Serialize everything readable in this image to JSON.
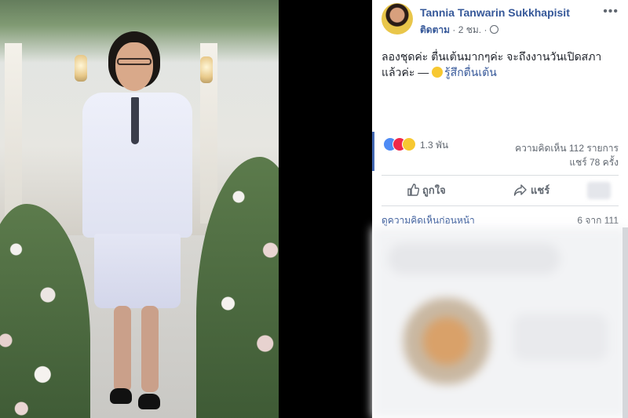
{
  "post": {
    "author": "Tannia Tanwarin Sukkhapisit",
    "follow_label": "ติดตาม",
    "dot": "·",
    "time": "2 ชม.",
    "more_icon": "•••",
    "text": "ลองชุดค่ะ ตื่นเต้นมากๆค่ะ จะถึงงานวันเปิดสภาแล้วค่ะ — ",
    "feeling": "รู้สึกตื่นเต้น"
  },
  "reactions": {
    "icons": [
      "like-icon",
      "love-icon",
      "wow-icon"
    ],
    "count": "1.3 พัน"
  },
  "stats": {
    "comments": "ความคิดเห็น 112 รายการ",
    "shares": "แชร์ 78 ครั้ง"
  },
  "actions": {
    "like": "ถูกใจ",
    "share": "แชร์"
  },
  "comments": {
    "view_previous": "ดูความคิดเห็นก่อนหน้า",
    "count": "6 จาก 111"
  },
  "colors": {
    "link": "#365899",
    "muted": "#606770",
    "accent": "#4267b2"
  }
}
